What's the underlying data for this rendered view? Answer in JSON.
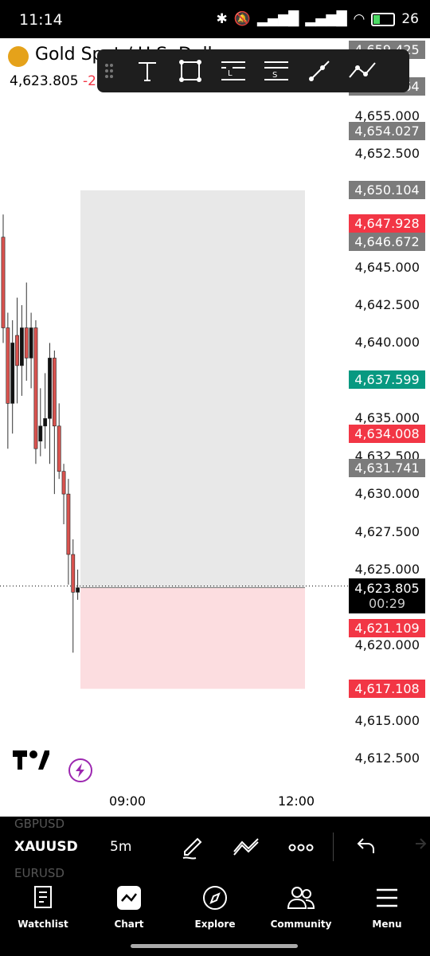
{
  "status": {
    "time": "11:14",
    "battery": "26"
  },
  "header": {
    "symbol_title": "Gold Spot / U.S. Dollar",
    "last_price": "4,623.805",
    "change": "-2"
  },
  "price_axis": {
    "labels": [
      "4,655.000",
      "4,652.500",
      "4,645.000",
      "4,642.500",
      "4,640.000",
      "4,635.000",
      "4,632.500",
      "4,630.000",
      "4,627.500",
      "4,625.000",
      "4,620.000",
      "4,615.000",
      "4,612.500"
    ]
  },
  "price_tags": [
    {
      "text": "4,659.425",
      "color": "#7b7b7b"
    },
    {
      "text": "4,656.964",
      "color": "#7b7b7b"
    },
    {
      "text": "4,654.027",
      "color": "#7b7b7b"
    },
    {
      "text": "4,650.104",
      "color": "#7b7b7b"
    },
    {
      "text": "4,647.928",
      "color": "#f23645"
    },
    {
      "text": "4,646.672",
      "color": "#7b7b7b"
    },
    {
      "text": "4,637.599",
      "color": "#089981"
    },
    {
      "text": "4,634.008",
      "color": "#f23645"
    },
    {
      "text": "4,631.741",
      "color": "#7b7b7b"
    },
    {
      "text": "4,621.109",
      "color": "#f23645"
    },
    {
      "text": "4,617.108",
      "color": "#f23645"
    }
  ],
  "current": {
    "price": "4,623.805",
    "countdown": "00:29"
  },
  "time_axis": {
    "t1": "09:00",
    "t2": "12:00"
  },
  "symbol_bar": {
    "symbol": "XAUUSD",
    "interval": "5m",
    "prev_symbol": "GBPUSD",
    "next_symbol": "EURUSD"
  },
  "nav": {
    "watchlist": "Watchlist",
    "chart": "Chart",
    "explore": "Explore",
    "community": "Community",
    "menu": "Menu"
  },
  "candles": [
    {
      "o": 4647.0,
      "h": 4648.5,
      "l": 4640.0,
      "c": 4641.0
    },
    {
      "o": 4641.0,
      "h": 4642.0,
      "l": 4633.0,
      "c": 4636.0
    },
    {
      "o": 4636.0,
      "h": 4641.5,
      "l": 4634.0,
      "c": 4640.0
    },
    {
      "o": 4640.5,
      "h": 4643.0,
      "l": 4636.0,
      "c": 4638.5
    },
    {
      "o": 4638.5,
      "h": 4642.5,
      "l": 4636.5,
      "c": 4641.0
    },
    {
      "o": 4641.0,
      "h": 4644.0,
      "l": 4637.5,
      "c": 4639.0
    },
    {
      "o": 4639.0,
      "h": 4642.0,
      "l": 4637.0,
      "c": 4641.0
    },
    {
      "o": 4641.0,
      "h": 4641.5,
      "l": 4632.0,
      "c": 4633.0
    },
    {
      "o": 4633.5,
      "h": 4637.0,
      "l": 4632.5,
      "c": 4634.5
    },
    {
      "o": 4634.5,
      "h": 4638.0,
      "l": 4633.0,
      "c": 4635.0
    },
    {
      "o": 4635.0,
      "h": 4640.0,
      "l": 4632.0,
      "c": 4639.0
    },
    {
      "o": 4639.0,
      "h": 4639.5,
      "l": 4630.0,
      "c": 4634.5
    },
    {
      "o": 4634.5,
      "h": 4636.0,
      "l": 4631.0,
      "c": 4631.5
    },
    {
      "o": 4631.5,
      "h": 4632.0,
      "l": 4628.0,
      "c": 4630.0
    },
    {
      "o": 4630.0,
      "h": 4631.0,
      "l": 4624.0,
      "c": 4626.0
    },
    {
      "o": 4626.0,
      "h": 4627.0,
      "l": 4619.5,
      "c": 4623.5
    },
    {
      "o": 4623.5,
      "h": 4625.0,
      "l": 4623.0,
      "c": 4623.8
    }
  ],
  "position": {
    "entry": 4623.805,
    "target": 4650.104,
    "stop": 4617.108
  }
}
